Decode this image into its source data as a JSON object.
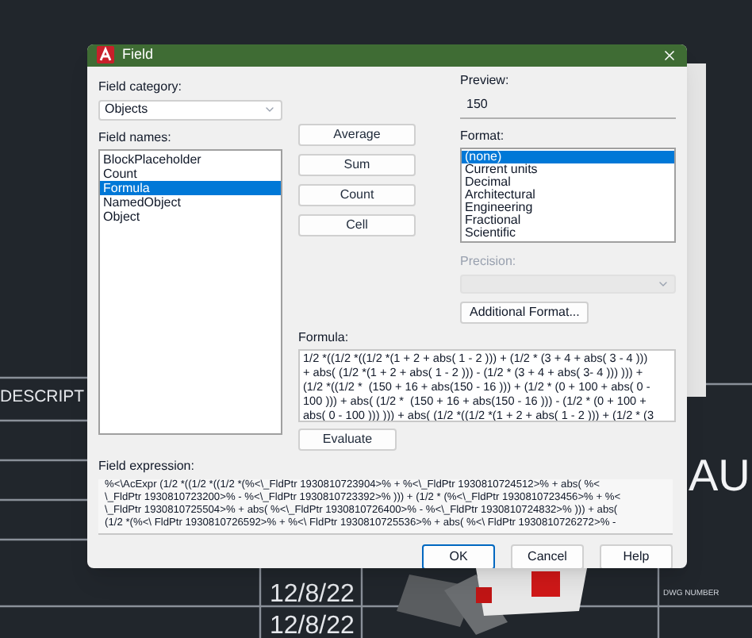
{
  "background": {
    "texts": [
      {
        "kind": "heading",
        "text": "DESCRIPT"
      },
      {
        "kind": "big",
        "text": "AU"
      },
      {
        "kind": "date",
        "text": "12/8/22"
      },
      {
        "kind": "date",
        "text": "12/8/22"
      },
      {
        "kind": "tiny",
        "text": "DWG NUMBER"
      }
    ]
  },
  "window": {
    "title": "Field"
  },
  "field_category": {
    "label": "Field category:",
    "value": "Objects"
  },
  "field_names": {
    "label": "Field names:",
    "items": [
      {
        "label": "BlockPlaceholder",
        "selected": false
      },
      {
        "label": "Count",
        "selected": false
      },
      {
        "label": "Formula",
        "selected": true
      },
      {
        "label": "NamedObject",
        "selected": false
      },
      {
        "label": "Object",
        "selected": false
      }
    ]
  },
  "function_buttons": [
    "Average",
    "Sum",
    "Count",
    "Cell"
  ],
  "preview": {
    "label": "Preview:",
    "value": "150"
  },
  "format": {
    "label": "Format:",
    "items": [
      {
        "label": "(none)",
        "selected": true
      },
      {
        "label": "Current units",
        "selected": false
      },
      {
        "label": "Decimal",
        "selected": false
      },
      {
        "label": "Architectural",
        "selected": false
      },
      {
        "label": "Engineering",
        "selected": false
      },
      {
        "label": "Fractional",
        "selected": false
      },
      {
        "label": "Scientific",
        "selected": false
      }
    ]
  },
  "precision": {
    "label": "Precision:",
    "disabled": true
  },
  "additional_format_button": "Additional Format...",
  "formula": {
    "label": "Formula:",
    "lines": [
      "1/2 *((1/2 *((1/2 *(1 + 2 + abs( 1 - 2 ))) + (1/2 * (3 + 4 + abs( 3 - 4 )))",
      "+ abs( (1/2 *(1 + 2 + abs( 1 - 2 ))) - (1/2 * (3 + 4 + abs( 3- 4 ))) ))) +",
      "(1/2 *((1/2 *  (150 + 16 + abs(150 - 16 ))) + (1/2 * (0 + 100 + abs( 0 -",
      "100 ))) + abs( (1/2 *  (150 + 16 + abs(150 - 16 ))) - (1/2 * (0 + 100 +",
      "abs( 0 - 100 ))) ))) + abs( (1/2 *((1/2 *(1 + 2 + abs( 1 - 2 ))) + (1/2 * (3"
    ]
  },
  "evaluate_button": "Evaluate",
  "field_expression": {
    "label": "Field expression:",
    "lines": [
      "%<\\AcExpr (1/2 *((1/2 *((1/2 *(%<\\_FldPtr 1930810723904>% + %<\\_FldPtr 1930810724512>% + abs( %<",
      "\\_FldPtr 1930810723200>% - %<\\_FldPtr 1930810723392>% ))) + (1/2 * (%<\\_FldPtr 1930810723456>% + %<",
      "\\_FldPtr 1930810725504>% + abs( %<\\_FldPtr 1930810726400>% - %<\\_FldPtr 1930810724832>% ))) + abs(",
      "(1/2 *(%<\\ FldPtr 1930810726592>% + %<\\ FldPtr 1930810725536>% + abs( %<\\ FldPtr 1930810726272>% -"
    ]
  },
  "buttons": [
    {
      "label": "OK",
      "default": true
    },
    {
      "label": "Cancel",
      "default": false
    },
    {
      "label": "Help",
      "default": false
    }
  ]
}
